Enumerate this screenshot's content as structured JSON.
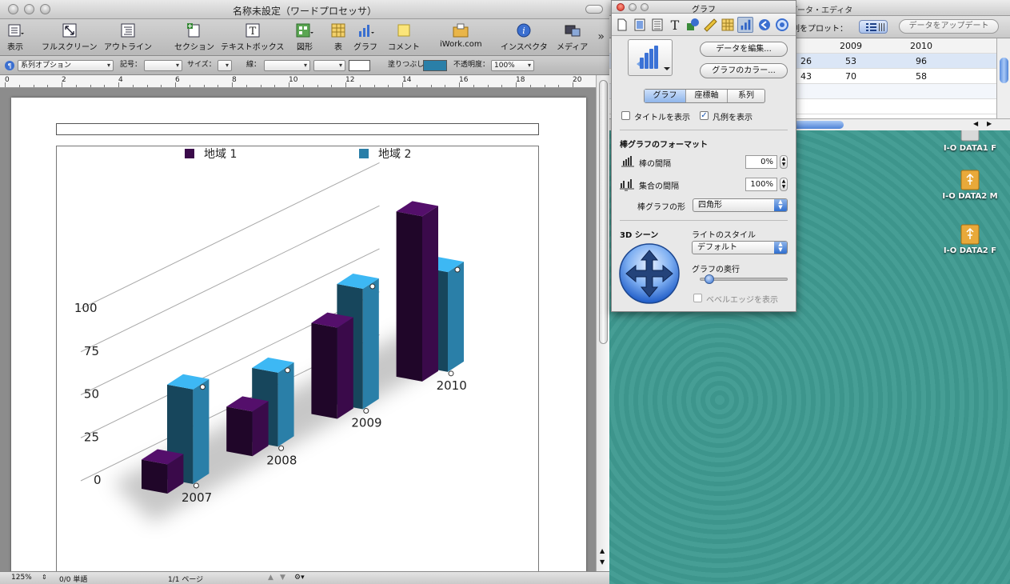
{
  "doc_window": {
    "title": "名称未設定（ワードプロセッサ）",
    "toolbar": [
      {
        "label": "表示",
        "icon": "view-icon"
      },
      {
        "label": "フルスクリーン",
        "icon": "fullscreen-icon"
      },
      {
        "label": "アウトライン",
        "icon": "outline-icon"
      },
      {
        "label": "セクション",
        "icon": "section-icon"
      },
      {
        "label": "テキストボックス",
        "icon": "textbox-icon"
      },
      {
        "label": "図形",
        "icon": "shapes-icon"
      },
      {
        "label": "表",
        "icon": "table-icon"
      },
      {
        "label": "グラフ",
        "icon": "chart-icon"
      },
      {
        "label": "コメント",
        "icon": "comment-icon"
      },
      {
        "label": "iWork.com",
        "icon": "iwork-icon"
      },
      {
        "label": "インスペクタ",
        "icon": "inspector-icon"
      },
      {
        "label": "メディア",
        "icon": "media-icon"
      }
    ],
    "format_bar": {
      "series_option": "系列オプション",
      "symbol_label": "記号：",
      "size_label": "サイズ：",
      "line_label": "線：",
      "fill_label": "塗りつぶし：",
      "fill_color": "#2a7fa8",
      "opacity_label": "不透明度：",
      "opacity_value": "100%"
    },
    "ruler_numbers": [
      "0",
      "2",
      "4",
      "6",
      "8",
      "10",
      "12",
      "14",
      "16",
      "18",
      "20"
    ],
    "statusbar": {
      "zoom": "125%",
      "word_count": "0/0 単語",
      "page": "1/1 ページ"
    }
  },
  "chart_data": {
    "type": "bar",
    "categories": [
      "2007",
      "2008",
      "2009",
      "2010"
    ],
    "series": [
      {
        "name": "地域 1",
        "values": [
          17,
          26,
          53,
          96
        ],
        "color": "#3a0a4a"
      },
      {
        "name": "地域 2",
        "values": [
          55,
          43,
          70,
          58
        ],
        "color": "#2a7fa8"
      }
    ],
    "yticks": [
      "0",
      "25",
      "50",
      "75",
      "100"
    ],
    "ylim": [
      0,
      100
    ],
    "legend": "top",
    "grid": true,
    "style": "3d"
  },
  "data_editor": {
    "title": "データ・エディタ",
    "plot_label": "列をプロット：",
    "update_button": "データをアップデート",
    "headers": [
      "2009",
      "2010"
    ],
    "rows": [
      [
        "26",
        "53",
        "96"
      ],
      [
        "43",
        "70",
        "58"
      ]
    ]
  },
  "desktop_icons": [
    {
      "label": "I-O DATA1 F",
      "icon": "usb-drive-icon"
    },
    {
      "label": "I-O DATA2 M",
      "icon": "usb-drive-icon"
    },
    {
      "label": "I-O DATA2 F",
      "icon": "usb-drive-icon"
    }
  ],
  "inspector": {
    "title": "グラフ",
    "edit_data_button": "データを編集...",
    "chart_colors_button": "グラフのカラー...",
    "tabs": [
      "グラフ",
      "座標軸",
      "系列"
    ],
    "show_title_label": "タイトルを表示",
    "show_title_checked": false,
    "show_legend_label": "凡例を表示",
    "show_legend_checked": true,
    "bar_format_heading": "棒グラフのフォーマット",
    "bar_gap_label": "棒の間隔",
    "bar_gap_value": "0%",
    "set_gap_label": "集合の間隔",
    "set_gap_value": "100%",
    "bar_shape_label": "棒グラフの形",
    "bar_shape_value": "四角形",
    "scene_heading": "3D シーン",
    "light_style_label": "ライトのスタイル",
    "light_style_value": "デフォルト",
    "depth_label": "グラフの奥行",
    "depth_value": 0.05,
    "bevel_label": "ベベルエッジを表示",
    "bevel_checked": false
  }
}
